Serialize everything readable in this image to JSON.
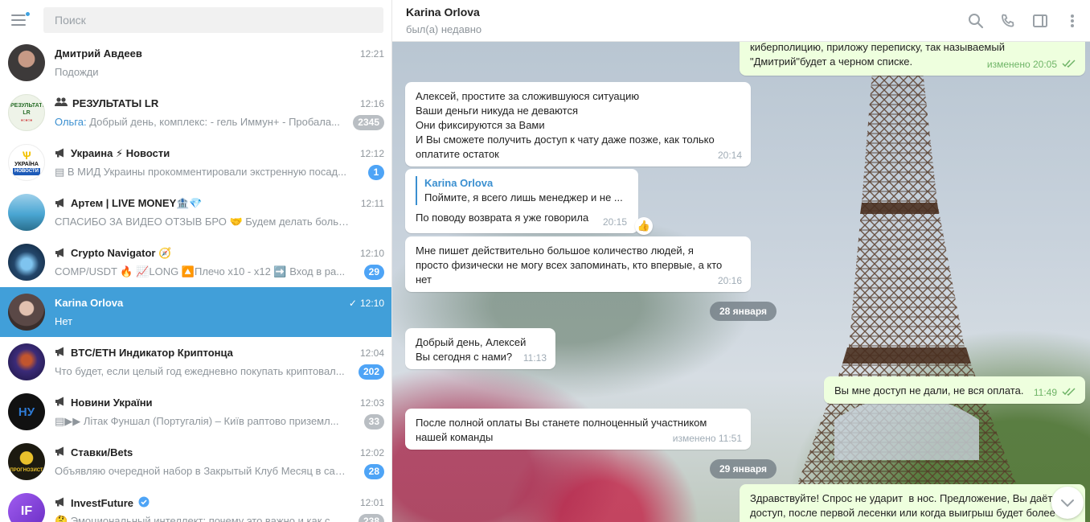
{
  "search": {
    "placeholder": "Поиск"
  },
  "chats": [
    {
      "name": "Дмитрий Авдеев",
      "time": "12:21",
      "preview": "Подожди",
      "sender": "",
      "badge": "",
      "prefix": "",
      "avatar": {
        "bg": "#5b6e7c",
        "text": ""
      }
    },
    {
      "name": "РЕЗУЛЬТАТЫ LR",
      "time": "12:16",
      "preview": " Добрый день, комплекс:  - гель Иммун+ - Пробала...",
      "sender": "Ольга:",
      "badge": "2345",
      "prefix": "group",
      "avatar": {
        "bg": "#e9f0e3",
        "text": ""
      }
    },
    {
      "name": "Украина ⚡ Новости",
      "time": "12:12",
      "preview": "▤ В МИД Украины прокомментировали экстренную посад...",
      "sender": "",
      "badge": "1",
      "prefix": "channel",
      "avatar": {
        "bg": "#ffffff",
        "text": ""
      }
    },
    {
      "name": "Артем | LIVE MONEY🏦💎",
      "time": "12:11",
      "preview": "СПАСИБО ЗА ВИДЕО ОТЗЫВ БРО 🤝  Будем делать больше и бо...",
      "sender": "",
      "badge": "",
      "prefix": "channel",
      "avatar": {
        "bg": "#3f8fbf",
        "text": ""
      }
    },
    {
      "name": "Crypto Navigator 🧭",
      "time": "12:10",
      "preview": "COMP/USDT 🔥  📈LONG  🔼Плечо x10 - x12  ➡️ Вход в ра...",
      "sender": "",
      "badge": "29",
      "prefix": "channel",
      "avatar": {
        "bg": "#1e3c5a",
        "text": ""
      }
    },
    {
      "name": "Karina Orlova",
      "time": "12:10",
      "preview": "Нет",
      "sender": "",
      "badge": "",
      "prefix": "",
      "avatar": {
        "bg": "#6b5a55",
        "text": ""
      }
    },
    {
      "name": "BTC/ETH Индикатор Криптонца",
      "time": "12:04",
      "preview": "Что будет, если целый год ежедневно покупать криптовал...",
      "sender": "",
      "badge": "202",
      "prefix": "channel",
      "avatar": {
        "bg": "#3a2a6e",
        "text": ""
      }
    },
    {
      "name": "Новини України",
      "time": "12:03",
      "preview": "▤▶▶ Літак Фуншал (Португалія) – Київ раптово приземл...",
      "sender": "",
      "badge": "33",
      "prefix": "channel",
      "avatar": {
        "bg": "#111111",
        "text": "НУ"
      }
    },
    {
      "name": "Ставки/Bets",
      "time": "12:02",
      "preview": "Объявляю очередной набор в Закрытый Клуб  Месяц в сам...",
      "sender": "",
      "badge": "28",
      "prefix": "channel",
      "avatar": {
        "bg": "#1c1a10",
        "text": ""
      }
    },
    {
      "name": "InvestFuture",
      "time": "12:01",
      "preview": "🤔 Эмоциональный интеллект: почему это важно и как с...",
      "sender": "",
      "badge": "238",
      "prefix": "channel",
      "avatar": {
        "bg": "#8b3fd8",
        "text": "IF"
      }
    }
  ],
  "avatar_labels": {
    "ukraine": "УКРАЇНА",
    "ukraine_sub": "НОВОСТИ",
    "bets": "ПРОГНОЗИСТ",
    "results": "РЕЗУЛЬТАТЫ LR"
  },
  "header": {
    "name": "Karina Orlova",
    "status": "был(а) недавно"
  },
  "messages": {
    "m0": {
      "text": "киберполицию, приложу переписку, так называемый\n\"Дмитрий\"будет а черном списке.",
      "meta": "изменено 20:05"
    },
    "m1": {
      "text": "Алексей, простите за сложившуюся ситуацию\nВаши деньги никуда не деваются\nОни фиксируются за Вами\nИ Вы сможете получить доступ к чату даже позже, как только\nоплатите остаток",
      "meta": "20:14"
    },
    "m2": {
      "reply_name": "Karina Orlova",
      "reply_text": "Поймите, я всего лишь менеджер и не ...",
      "text": "По поводу возврата я уже говорила",
      "meta": "20:15",
      "reaction": "👍"
    },
    "m3": {
      "text": "Мне пишет действительно большое количество людей, я\nпросто физически не могу всех запоминать, кто впервые, а кто\nнет",
      "meta": "20:16"
    },
    "d1": "28 января",
    "m4": {
      "text": "Добрый день, Алексей\nВы сегодня с нами?",
      "meta": "11:13"
    },
    "m5": {
      "text": "Вы мне доступ не дали, не вся оплата.",
      "meta": "11:49"
    },
    "m6": {
      "text": "После полной оплаты Вы станете полноценный участником\nнашей команды",
      "meta": "изменено 11:51"
    },
    "d2": "29 января",
    "m7": {
      "text": "Здравствуйте! Спрос не ударит  в нос. Предложение, Вы даёте\nдоступ, после первой лесенки или когда выигрыш будет более"
    }
  },
  "colors": {
    "accent": "#419fd9",
    "badge": "#4ea4f6",
    "badge_muted": "#b9bec3",
    "outgoing": "#eeffde"
  }
}
